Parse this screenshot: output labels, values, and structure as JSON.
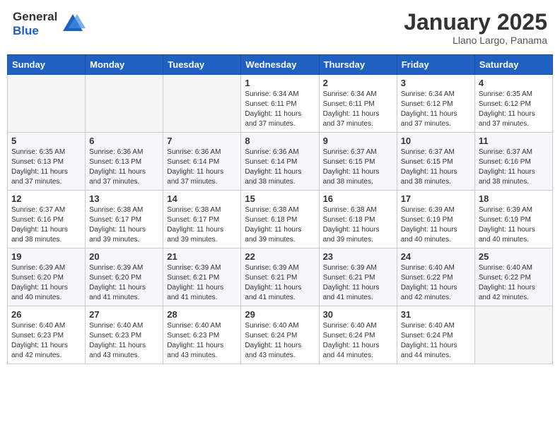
{
  "header": {
    "logo_general": "General",
    "logo_blue": "Blue",
    "month_title": "January 2025",
    "subtitle": "Llano Largo, Panama"
  },
  "weekdays": [
    "Sunday",
    "Monday",
    "Tuesday",
    "Wednesday",
    "Thursday",
    "Friday",
    "Saturday"
  ],
  "weeks": [
    [
      {
        "day": "",
        "sunrise": "",
        "sunset": "",
        "daylight": ""
      },
      {
        "day": "",
        "sunrise": "",
        "sunset": "",
        "daylight": ""
      },
      {
        "day": "",
        "sunrise": "",
        "sunset": "",
        "daylight": ""
      },
      {
        "day": "1",
        "sunrise": "Sunrise: 6:34 AM",
        "sunset": "Sunset: 6:11 PM",
        "daylight": "Daylight: 11 hours and 37 minutes."
      },
      {
        "day": "2",
        "sunrise": "Sunrise: 6:34 AM",
        "sunset": "Sunset: 6:11 PM",
        "daylight": "Daylight: 11 hours and 37 minutes."
      },
      {
        "day": "3",
        "sunrise": "Sunrise: 6:34 AM",
        "sunset": "Sunset: 6:12 PM",
        "daylight": "Daylight: 11 hours and 37 minutes."
      },
      {
        "day": "4",
        "sunrise": "Sunrise: 6:35 AM",
        "sunset": "Sunset: 6:12 PM",
        "daylight": "Daylight: 11 hours and 37 minutes."
      }
    ],
    [
      {
        "day": "5",
        "sunrise": "Sunrise: 6:35 AM",
        "sunset": "Sunset: 6:13 PM",
        "daylight": "Daylight: 11 hours and 37 minutes."
      },
      {
        "day": "6",
        "sunrise": "Sunrise: 6:36 AM",
        "sunset": "Sunset: 6:13 PM",
        "daylight": "Daylight: 11 hours and 37 minutes."
      },
      {
        "day": "7",
        "sunrise": "Sunrise: 6:36 AM",
        "sunset": "Sunset: 6:14 PM",
        "daylight": "Daylight: 11 hours and 37 minutes."
      },
      {
        "day": "8",
        "sunrise": "Sunrise: 6:36 AM",
        "sunset": "Sunset: 6:14 PM",
        "daylight": "Daylight: 11 hours and 38 minutes."
      },
      {
        "day": "9",
        "sunrise": "Sunrise: 6:37 AM",
        "sunset": "Sunset: 6:15 PM",
        "daylight": "Daylight: 11 hours and 38 minutes."
      },
      {
        "day": "10",
        "sunrise": "Sunrise: 6:37 AM",
        "sunset": "Sunset: 6:15 PM",
        "daylight": "Daylight: 11 hours and 38 minutes."
      },
      {
        "day": "11",
        "sunrise": "Sunrise: 6:37 AM",
        "sunset": "Sunset: 6:16 PM",
        "daylight": "Daylight: 11 hours and 38 minutes."
      }
    ],
    [
      {
        "day": "12",
        "sunrise": "Sunrise: 6:37 AM",
        "sunset": "Sunset: 6:16 PM",
        "daylight": "Daylight: 11 hours and 38 minutes."
      },
      {
        "day": "13",
        "sunrise": "Sunrise: 6:38 AM",
        "sunset": "Sunset: 6:17 PM",
        "daylight": "Daylight: 11 hours and 39 minutes."
      },
      {
        "day": "14",
        "sunrise": "Sunrise: 6:38 AM",
        "sunset": "Sunset: 6:17 PM",
        "daylight": "Daylight: 11 hours and 39 minutes."
      },
      {
        "day": "15",
        "sunrise": "Sunrise: 6:38 AM",
        "sunset": "Sunset: 6:18 PM",
        "daylight": "Daylight: 11 hours and 39 minutes."
      },
      {
        "day": "16",
        "sunrise": "Sunrise: 6:38 AM",
        "sunset": "Sunset: 6:18 PM",
        "daylight": "Daylight: 11 hours and 39 minutes."
      },
      {
        "day": "17",
        "sunrise": "Sunrise: 6:39 AM",
        "sunset": "Sunset: 6:19 PM",
        "daylight": "Daylight: 11 hours and 40 minutes."
      },
      {
        "day": "18",
        "sunrise": "Sunrise: 6:39 AM",
        "sunset": "Sunset: 6:19 PM",
        "daylight": "Daylight: 11 hours and 40 minutes."
      }
    ],
    [
      {
        "day": "19",
        "sunrise": "Sunrise: 6:39 AM",
        "sunset": "Sunset: 6:20 PM",
        "daylight": "Daylight: 11 hours and 40 minutes."
      },
      {
        "day": "20",
        "sunrise": "Sunrise: 6:39 AM",
        "sunset": "Sunset: 6:20 PM",
        "daylight": "Daylight: 11 hours and 41 minutes."
      },
      {
        "day": "21",
        "sunrise": "Sunrise: 6:39 AM",
        "sunset": "Sunset: 6:21 PM",
        "daylight": "Daylight: 11 hours and 41 minutes."
      },
      {
        "day": "22",
        "sunrise": "Sunrise: 6:39 AM",
        "sunset": "Sunset: 6:21 PM",
        "daylight": "Daylight: 11 hours and 41 minutes."
      },
      {
        "day": "23",
        "sunrise": "Sunrise: 6:39 AM",
        "sunset": "Sunset: 6:21 PM",
        "daylight": "Daylight: 11 hours and 41 minutes."
      },
      {
        "day": "24",
        "sunrise": "Sunrise: 6:40 AM",
        "sunset": "Sunset: 6:22 PM",
        "daylight": "Daylight: 11 hours and 42 minutes."
      },
      {
        "day": "25",
        "sunrise": "Sunrise: 6:40 AM",
        "sunset": "Sunset: 6:22 PM",
        "daylight": "Daylight: 11 hours and 42 minutes."
      }
    ],
    [
      {
        "day": "26",
        "sunrise": "Sunrise: 6:40 AM",
        "sunset": "Sunset: 6:23 PM",
        "daylight": "Daylight: 11 hours and 42 minutes."
      },
      {
        "day": "27",
        "sunrise": "Sunrise: 6:40 AM",
        "sunset": "Sunset: 6:23 PM",
        "daylight": "Daylight: 11 hours and 43 minutes."
      },
      {
        "day": "28",
        "sunrise": "Sunrise: 6:40 AM",
        "sunset": "Sunset: 6:23 PM",
        "daylight": "Daylight: 11 hours and 43 minutes."
      },
      {
        "day": "29",
        "sunrise": "Sunrise: 6:40 AM",
        "sunset": "Sunset: 6:24 PM",
        "daylight": "Daylight: 11 hours and 43 minutes."
      },
      {
        "day": "30",
        "sunrise": "Sunrise: 6:40 AM",
        "sunset": "Sunset: 6:24 PM",
        "daylight": "Daylight: 11 hours and 44 minutes."
      },
      {
        "day": "31",
        "sunrise": "Sunrise: 6:40 AM",
        "sunset": "Sunset: 6:24 PM",
        "daylight": "Daylight: 11 hours and 44 minutes."
      },
      {
        "day": "",
        "sunrise": "",
        "sunset": "",
        "daylight": ""
      }
    ]
  ]
}
